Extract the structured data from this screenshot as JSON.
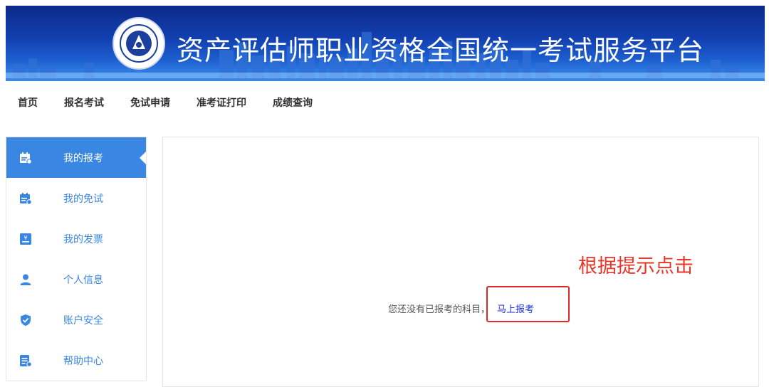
{
  "banner": {
    "title": "资产评估师职业资格全国统一考试服务平台",
    "logo_icon": "association-logo-icon"
  },
  "nav": {
    "items": [
      "首页",
      "报名考试",
      "免试申请",
      "准考证打印",
      "成绩查询"
    ]
  },
  "sidebar": {
    "items": [
      {
        "label": "我的报考",
        "icon": "calendar-icon",
        "active": true
      },
      {
        "label": "我的免试",
        "icon": "calendar-check-icon",
        "active": false
      },
      {
        "label": "我的发票",
        "icon": "invoice-icon",
        "active": false
      },
      {
        "label": "个人信息",
        "icon": "user-icon",
        "active": false
      },
      {
        "label": "账户安全",
        "icon": "shield-icon",
        "active": false
      },
      {
        "label": "帮助中心",
        "icon": "help-doc-icon",
        "active": false
      }
    ]
  },
  "main": {
    "empty_message": "您还没有已报考的科目，",
    "apply_link": "马上报考"
  },
  "annotation": {
    "text": "根据提示点击"
  },
  "colors": {
    "accent": "#3a87e3",
    "banner": "#1240b0",
    "link": "#1a2fd8",
    "annotation": "#e8352a"
  }
}
